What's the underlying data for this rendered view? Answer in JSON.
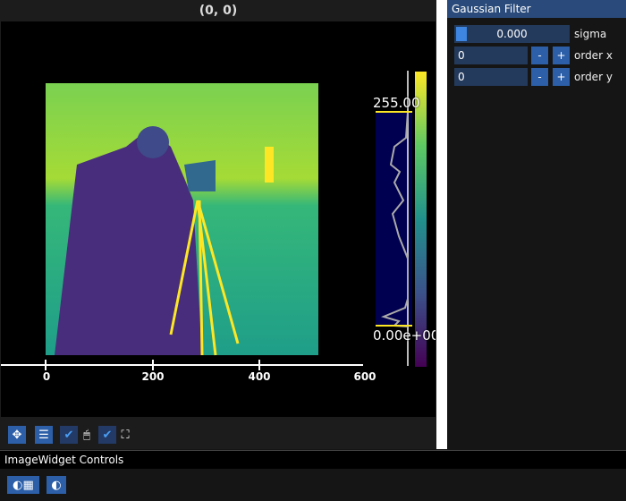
{
  "window": {
    "title": "(0, 0)"
  },
  "plot": {
    "x_ticks": [
      "0",
      "200",
      "400",
      "600"
    ],
    "histogram": {
      "max_label": "255.00",
      "min_label": "0.00e+00"
    },
    "colormap": "viridis"
  },
  "toolbar": {
    "buttons": [
      {
        "icon": "expand-icon"
      },
      {
        "icon": "align-center-icon"
      },
      {
        "icon": "checkbox-checked-icon",
        "checked": true
      },
      {
        "icon": "mouse-icon"
      },
      {
        "icon": "checkbox-checked-icon",
        "checked": true
      },
      {
        "icon": "fullscreen-icon"
      }
    ]
  },
  "gaussian": {
    "title": "Gaussian Filter",
    "sigma_value": "0.000",
    "sigma_fraction": 0,
    "sigma_label": "sigma",
    "order_x_value": "0",
    "order_x_label": "order x",
    "order_y_value": "0",
    "order_y_label": "order y",
    "minus": "-",
    "plus": "+"
  },
  "controls": {
    "title": "ImageWidget Controls"
  },
  "colors": {
    "accent": "#2c5fa8",
    "header": "#294a7a"
  }
}
